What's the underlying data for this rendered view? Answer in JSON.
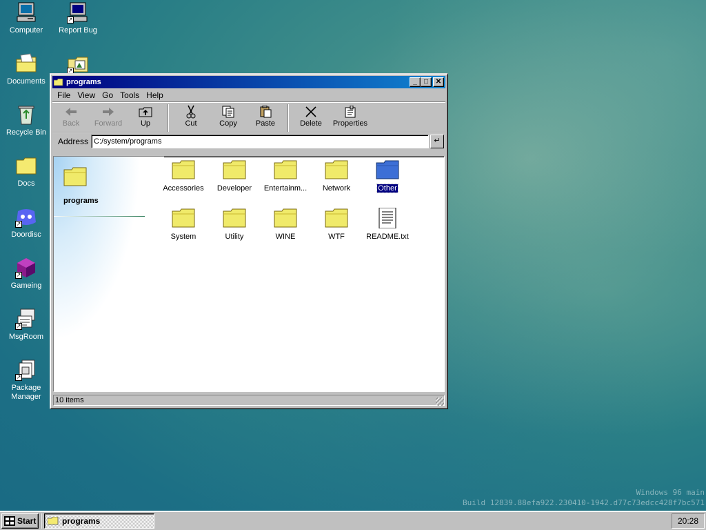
{
  "desktop": {
    "icons": [
      {
        "label": "Computer",
        "icon": "computer-icon"
      },
      {
        "label": "Report Bug",
        "icon": "report-bug-icon"
      },
      {
        "label": "Documents",
        "icon": "documents-icon"
      },
      {
        "label": "",
        "icon": "program-shortcut-icon"
      },
      {
        "label": "Recycle Bin",
        "icon": "recycle-bin-icon"
      },
      {
        "label": "Docs",
        "icon": "folder-icon"
      },
      {
        "label": "Doordisc",
        "icon": "doordisc-icon"
      },
      {
        "label": "Gameing",
        "icon": "gameing-icon"
      },
      {
        "label": "MsgRoom",
        "icon": "msgroom-icon"
      },
      {
        "label": "Package Manager",
        "icon": "package-manager-icon"
      }
    ],
    "watermark": {
      "line1": "Windows 96 main",
      "line2": "Build 12839.88efa922.230410-1942.d77c73edcc428f7bc571"
    }
  },
  "window": {
    "title": "programs",
    "menu": [
      "File",
      "View",
      "Go",
      "Tools",
      "Help"
    ],
    "toolbar": {
      "back": "Back",
      "forward": "Forward",
      "up": "Up",
      "cut": "Cut",
      "copy": "Copy",
      "paste": "Paste",
      "delete": "Delete",
      "properties": "Properties"
    },
    "address": {
      "label": "Address",
      "value": "C:/system/programs",
      "go": "↵"
    },
    "sidepane_title": "programs",
    "items": [
      {
        "label": "Accessories",
        "type": "folder"
      },
      {
        "label": "Developer",
        "type": "folder"
      },
      {
        "label": "Entertainm...",
        "type": "folder"
      },
      {
        "label": "Network",
        "type": "folder"
      },
      {
        "label": "Other",
        "type": "folder",
        "selected": true
      },
      {
        "label": "System",
        "type": "folder"
      },
      {
        "label": "Utility",
        "type": "folder"
      },
      {
        "label": "WINE",
        "type": "folder"
      },
      {
        "label": "WTF",
        "type": "folder"
      },
      {
        "label": "README.txt",
        "type": "text-file"
      }
    ],
    "status": "10 items"
  },
  "taskbar": {
    "start_label": "Start",
    "task_label": "programs",
    "clock": "20:28"
  },
  "colors": {
    "folder_yellow": "#f0ea6a",
    "folder_selected_blue": "#3d6fd6",
    "titlebar_start": "#000080",
    "titlebar_end": "#1084d0"
  }
}
